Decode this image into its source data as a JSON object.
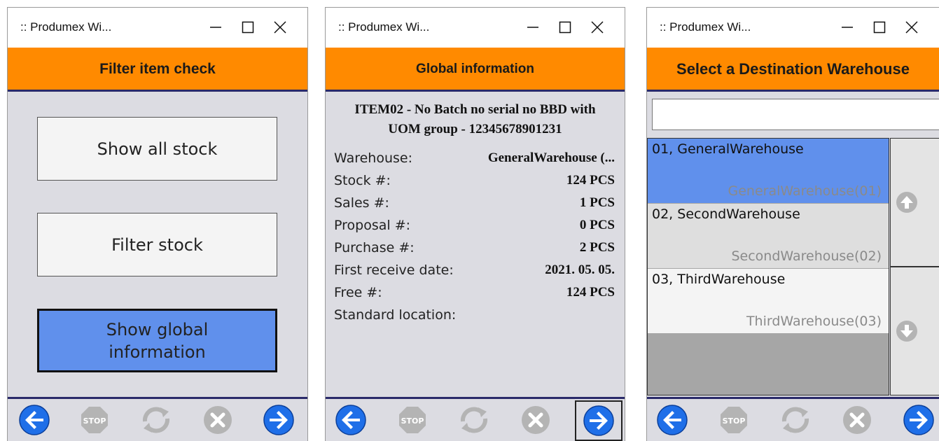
{
  "windows": [
    {
      "title": ":: Produmex Wi...",
      "header": "Filter item check",
      "buttons": [
        {
          "label": "Show all stock"
        },
        {
          "label": "Filter stock"
        },
        {
          "label": "Show global\ninformation",
          "selected": true
        }
      ]
    },
    {
      "title": ":: Produmex Wi...",
      "header": "Global information",
      "item_title": "ITEM02 - No Batch no serial no BBD with\nUOM group - 12345678901231",
      "rows": [
        {
          "label": "Warehouse:",
          "value": "GeneralWarehouse (..."
        },
        {
          "label": "Stock #:",
          "value": "124 PCS"
        },
        {
          "label": "Sales #:",
          "value": "1 PCS"
        },
        {
          "label": "Proposal #:",
          "value": "0 PCS"
        },
        {
          "label": "Purchase #:",
          "value": "2 PCS"
        },
        {
          "label": "First receive date:",
          "value": "2021. 05. 05."
        },
        {
          "label": "Free #:",
          "value": "124 PCS"
        },
        {
          "label": "Standard location:",
          "value": ""
        }
      ]
    },
    {
      "title": ":: Produmex Wi...",
      "header": "Select a Destination Warehouse",
      "search_value": "",
      "warehouses": [
        {
          "name": "01, GeneralWarehouse",
          "code": "GeneralWarehouse(01)",
          "selected": true
        },
        {
          "name": "02, SecondWarehouse",
          "code": "SecondWarehouse(02)"
        },
        {
          "name": "03, ThirdWarehouse",
          "code": "ThirdWarehouse(03)"
        }
      ]
    }
  ],
  "toolbar_icons": [
    "back-arrow-icon",
    "stop-icon",
    "refresh-icon",
    "cancel-icon",
    "next-arrow-icon"
  ],
  "stop_text": "STOP",
  "colors": {
    "header": "#ff8a00",
    "content_bg": "#dcdce2",
    "selected": "#6090ec",
    "nav_blue": "#1f6fe8",
    "disabled_gray": "#b4b4b4"
  }
}
